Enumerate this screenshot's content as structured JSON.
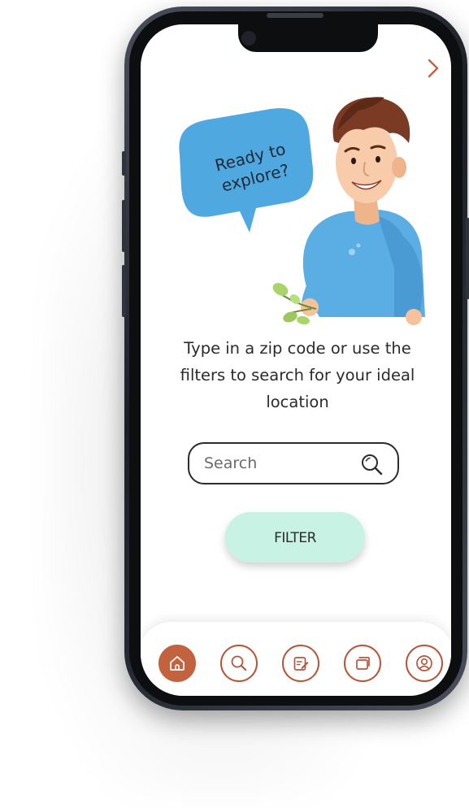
{
  "speech_bubble": {
    "text": "Ready to explore?"
  },
  "intro": {
    "description": "Type in a zip code or use the filters to search for your ideal location"
  },
  "search": {
    "placeholder": "Search",
    "value": ""
  },
  "filter": {
    "label": "FILTER"
  },
  "nav": {
    "next_icon": "chevron-right-icon",
    "tabs": [
      {
        "id": "home",
        "icon": "home-icon",
        "active": true
      },
      {
        "id": "search",
        "icon": "search-icon",
        "active": false
      },
      {
        "id": "notes",
        "icon": "edit-note-icon",
        "active": false
      },
      {
        "id": "collections",
        "icon": "layers-icon",
        "active": false
      },
      {
        "id": "profile",
        "icon": "user-icon",
        "active": false
      }
    ]
  },
  "colors": {
    "accent": "#c3623f",
    "filter_bg": "#c8f3e4",
    "bubble": "#4fa8e0",
    "sweater": "#5aaee4"
  }
}
